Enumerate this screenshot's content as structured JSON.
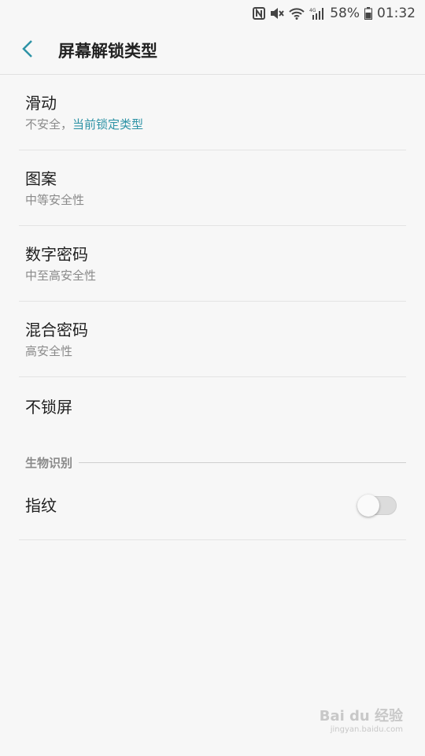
{
  "status_bar": {
    "battery_percent": "58%",
    "time": "01:32",
    "network": "4G",
    "icons": [
      "nfc-icon",
      "mute-icon",
      "wifi-icon",
      "signal-icon",
      "battery-icon"
    ]
  },
  "header": {
    "title": "屏幕解锁类型",
    "back_icon": "chevron-left-icon",
    "accent_color": "#2e93a6"
  },
  "options": [
    {
      "title": "滑动",
      "subtitle": "不安全，",
      "subtitle_accent": "当前锁定类型"
    },
    {
      "title": "图案",
      "subtitle": "中等安全性"
    },
    {
      "title": "数字密码",
      "subtitle": "中至高安全性"
    },
    {
      "title": "混合密码",
      "subtitle": "高安全性"
    },
    {
      "title": "不锁屏"
    }
  ],
  "biometrics": {
    "section_label": "生物识别",
    "fingerprint_label": "指纹",
    "fingerprint_enabled": false
  },
  "watermark": {
    "text": "Bai du 经验",
    "sub": "jingyan.baidu.com"
  }
}
